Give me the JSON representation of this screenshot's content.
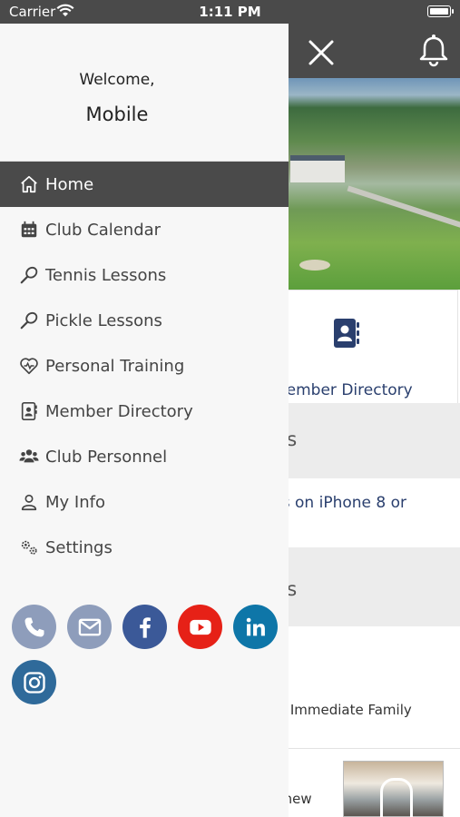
{
  "status_bar": {
    "carrier": "Carrier",
    "time": "1:11 PM"
  },
  "app": {
    "card_label": "Member Directory",
    "section1": "ts",
    "news1": "ns on iPhone 8 or",
    "section2": "ts",
    "news2": "at Immediate Family",
    "news3": "s new"
  },
  "drawer": {
    "welcome": "Welcome,",
    "user_name": "Mobile",
    "menu": [
      {
        "label": "Home",
        "icon": "home-icon",
        "active": true
      },
      {
        "label": "Club Calendar",
        "icon": "calendar-icon"
      },
      {
        "label": "Tennis Lessons",
        "icon": "racket-icon"
      },
      {
        "label": "Pickle Lessons",
        "icon": "racket-icon"
      },
      {
        "label": "Personal Training",
        "icon": "heart-pulse-icon"
      },
      {
        "label": "Member Directory",
        "icon": "contacts-icon"
      },
      {
        "label": "Club Personnel",
        "icon": "people-icon"
      },
      {
        "label": "My Info",
        "icon": "user-icon"
      },
      {
        "label": "Settings",
        "icon": "gears-icon"
      }
    ],
    "socials": [
      {
        "name": "phone",
        "color": "#8e9dbb"
      },
      {
        "name": "email",
        "color": "#8e9dbb"
      },
      {
        "name": "facebook",
        "color": "#3b5998"
      },
      {
        "name": "youtube",
        "color": "#e62117"
      },
      {
        "name": "linkedin",
        "color": "#0e76a8"
      },
      {
        "name": "instagram",
        "color": "#2f6a9a"
      }
    ]
  }
}
